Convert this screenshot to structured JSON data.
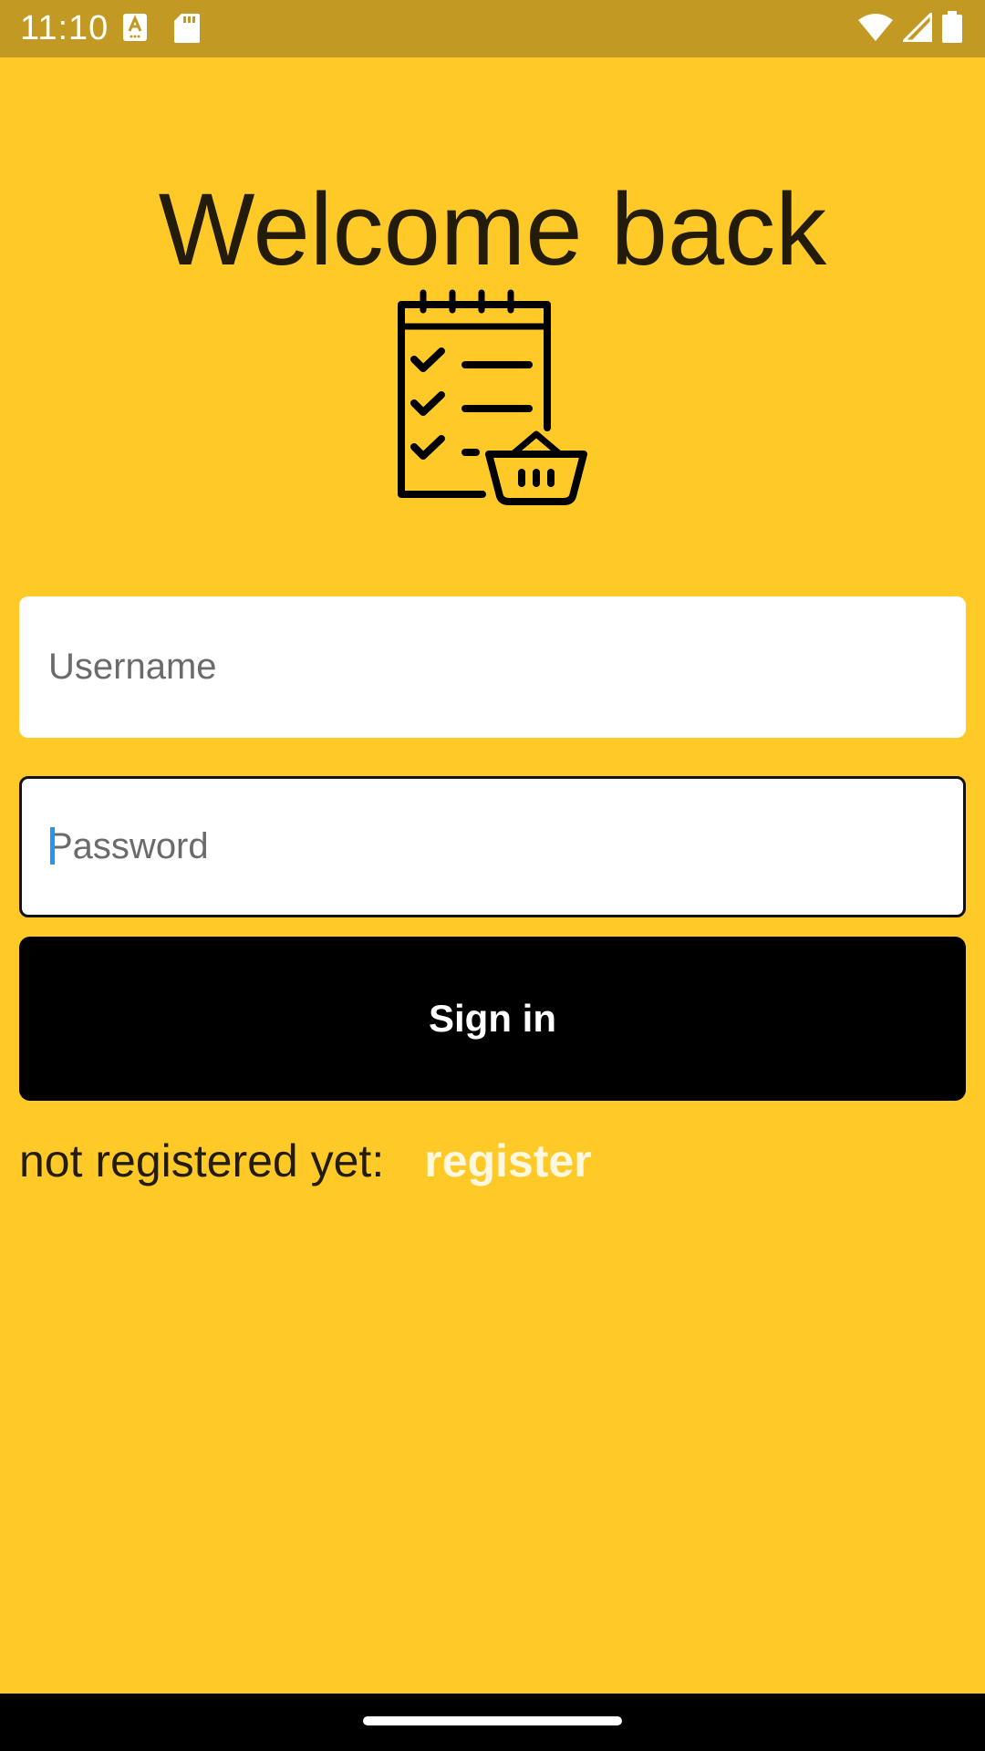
{
  "status_bar": {
    "time": "11:10",
    "icons": [
      "a-accessibility-icon",
      "sd-card-icon",
      "wifi-icon",
      "cell-signal-icon",
      "battery-icon"
    ]
  },
  "login": {
    "title": "Welcome back",
    "logo_icon": "checklist-basket-icon",
    "username_placeholder": "Username",
    "password_placeholder": "Password",
    "sign_in_label": "Sign in",
    "register_prompt": "not registered yet:",
    "register_link": "register"
  },
  "colors": {
    "background": "#FFCA28",
    "status_bar": "#C29923",
    "button": "#000000",
    "register_link": "#FFF8E1",
    "cursor": "#2196F3"
  }
}
